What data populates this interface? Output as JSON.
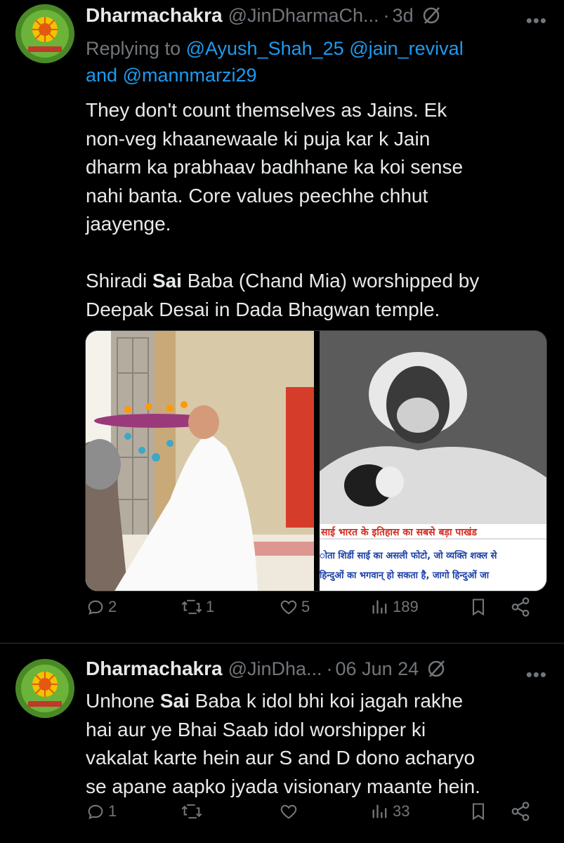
{
  "tweets": [
    {
      "author_name": "Dharmachakra",
      "handle": "@JinDharmaCh...",
      "time": "3d",
      "reply_prefix": "Replying to",
      "reply_to": [
        "@Ayush_Shah_25",
        "@jain_revival"
      ],
      "reply_and": "and",
      "reply_to_last": "@mannmarzi29",
      "text_part1": "They don't count themselves as Jains. Ek\nnon-veg khaanewaale ki puja kar k Jain\ndharm ka prabhaav badhhane ka koi sense\nnahi banta. Core values peechhe chhut\njaayenge.\n\nShiradi ",
      "text_bold": "Sai",
      "text_part2": " Baba (Chand Mia) worshipped by\nDeepak Desai in Dada Bhagwan temple.",
      "image_caption_line1": "साई भारत के इतिहास का सबसे बड़ा पाखंड",
      "image_caption_line2": "ोता शिर्डी साई का असली फोटो, जो व्यक्ति शक्ल से",
      "image_caption_line3": "हिन्दुओं का भगवान् हो सकता है, जागो हिन्दुओं जा",
      "replies": "2",
      "reposts": "1",
      "likes": "5",
      "views": "189"
    },
    {
      "author_name": "Dharmachakra",
      "handle": "@JinDha...",
      "time": "06 Jun 24",
      "text_part1": "Unhone ",
      "text_bold": "Sai",
      "text_part2": " Baba k idol bhi koi jagah rakhe\nhai aur ye Bhai Saab idol worshipper ki\nvakalat karte hein aur S and D dono acharyo\nse apane aapko jyada visionary maante hein.",
      "replies": "1",
      "reposts": "",
      "likes": "",
      "views": "33"
    }
  ],
  "colors": {
    "background": "#000000",
    "text": "#e7e9ea",
    "muted": "#71767b",
    "link": "#1d9bf0",
    "divider": "#2f3336"
  },
  "icons": [
    "reply-icon",
    "repost-icon",
    "like-icon",
    "views-icon",
    "bookmark-icon",
    "share-icon",
    "grok-icon",
    "more-icon"
  ]
}
